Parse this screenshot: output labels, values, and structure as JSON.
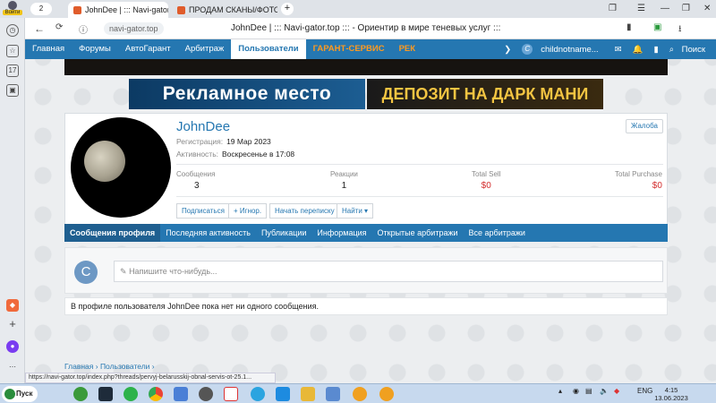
{
  "browser": {
    "profile_label": "Войти",
    "tab_count": "2",
    "tabs": [
      {
        "title": "JohnDee | ::: Navi-gator"
      },
      {
        "title": "ПРОДАМ СКАНЫ/ФОТО Г"
      }
    ],
    "url": "navi-gator.top",
    "page_title": "JohnDee | ::: Navi-gator.top ::: - Ориентир в мире теневых услуг :::",
    "status_url": "https://navi-gator.top/index.php?threads/pervyj-belarusskij-obnal-servis-ot-25.1..."
  },
  "site": {
    "nav": [
      "Главная",
      "Форумы",
      "АвтоГарант",
      "Арбитраж",
      "Пользователи",
      "ГАРАНТ-СЕРВИС",
      "РЕК"
    ],
    "nav_user": "childnotname...",
    "search_label": "Поиск",
    "ad1": "Рекламное место",
    "ad2": "ДЕПОЗИТ НА ДАРК МАНИ"
  },
  "profile": {
    "username": "JohnDee",
    "report": "Жалоба",
    "registration_label": "Регистрация:",
    "registration_value": "19 Мар 2023",
    "activity_label": "Активность:",
    "activity_value": "Воскресенье в 17:08",
    "stats": [
      {
        "label": "Сообщения",
        "value": "3"
      },
      {
        "label": "Реакции",
        "value": "1"
      },
      {
        "label": "Total Sell",
        "value": "$0"
      },
      {
        "label": "Total Purchase",
        "value": "$0"
      }
    ],
    "actions": [
      "Подписаться",
      "+ Игнор.",
      "Начать переписку",
      "Найти ▾"
    ],
    "tabs": [
      "Сообщения профиля",
      "Последняя активность",
      "Публикации",
      "Информация",
      "Открытые арбитражи",
      "Все арбитражи"
    ],
    "post_avatar_letter": "C",
    "post_placeholder": "Напишите что-нибудь...",
    "empty_message": "В профиле пользователя JohnDee пока нет ни одного сообщения."
  },
  "breadcrumb": [
    "Главная",
    "Пользователи"
  ],
  "taskbar": {
    "start_label": "Пуск",
    "lang": "ENG",
    "time": "4:15",
    "date": "13.06.2023"
  }
}
